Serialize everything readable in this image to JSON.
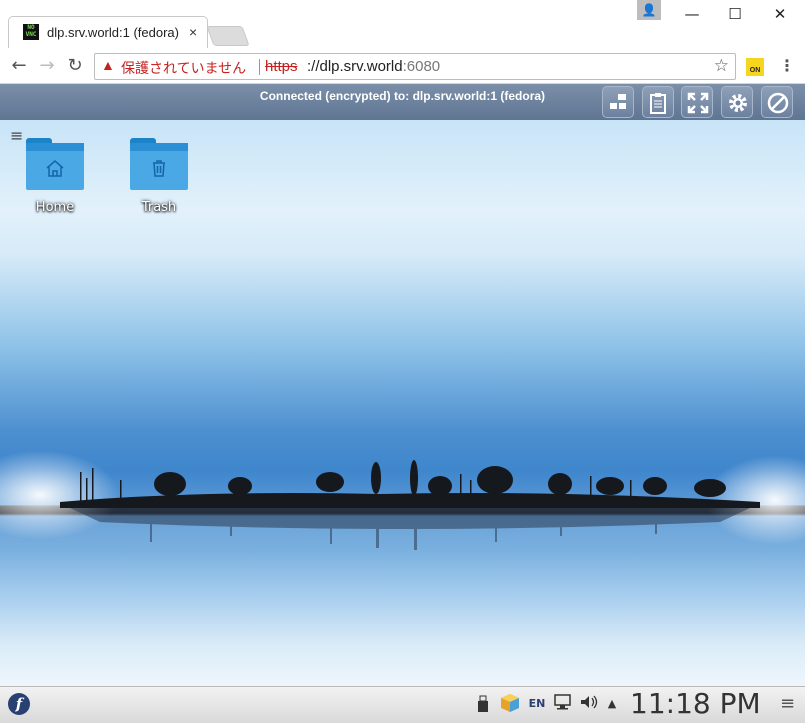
{
  "browser": {
    "tab": {
      "title": "dlp.srv.world:1 (fedora)",
      "favicon": "novnc-icon",
      "close": "×"
    },
    "window_controls": {
      "minimize": "—",
      "maximize": "☐",
      "close": "✕"
    },
    "toolbar": {
      "back": "←",
      "forward": "→",
      "reload": "↻",
      "security_warning": "保護されていません",
      "url_scheme": "https",
      "url_host": "://dlp.srv.world",
      "url_port": ":6080",
      "extension_label": "ON",
      "menu": "⋮"
    }
  },
  "vnc": {
    "status": "Connected (encrypted) to: dlp.srv.world:1 (fedora)",
    "buttons": [
      "extra-keys",
      "clipboard",
      "fullscreen",
      "settings",
      "disconnect"
    ]
  },
  "desktop": {
    "menu_glyph": "≡",
    "icons": [
      {
        "label": "Home",
        "icon": "home-folder-icon"
      },
      {
        "label": "Trash",
        "icon": "trash-folder-icon"
      }
    ]
  },
  "panel": {
    "lang": "EN",
    "clock": "11:18 PM",
    "menu": "≡",
    "up_arrow": "▲"
  },
  "colors": {
    "vnc_bar": "#6f84a0",
    "folder": "#4aa9e4",
    "warning": "#c5221f"
  }
}
